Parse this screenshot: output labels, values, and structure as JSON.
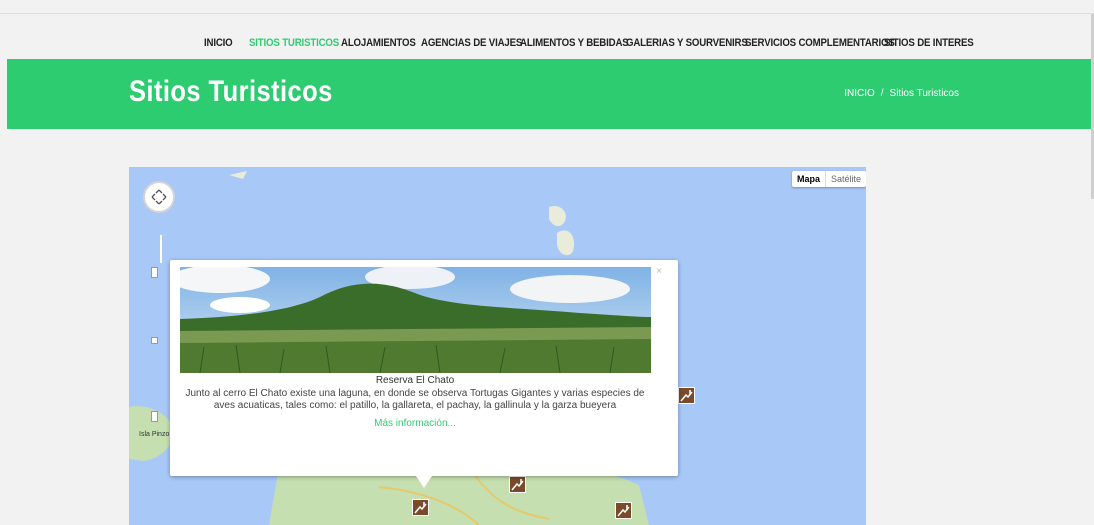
{
  "nav": {
    "items": [
      {
        "label": "INICIO",
        "active": false
      },
      {
        "label": "SITIOS TURISTICOS",
        "active": true
      },
      {
        "label": "ALOJAMIENTOS",
        "active": false
      },
      {
        "label": "AGENCIAS DE VIAJES",
        "active": false
      },
      {
        "label": "ALIMENTOS Y BEBIDAS",
        "active": false
      },
      {
        "label": "GALERIAS Y SOURVENIRS",
        "active": false
      },
      {
        "label": "SERVICIOS COMPLEMENTARIOS",
        "active": false
      },
      {
        "label": "SITIOS DE INTERES",
        "active": false
      }
    ]
  },
  "hero": {
    "title": "Sitios Turisticos",
    "breadcrumb": {
      "home": "INICIO",
      "separator": "/",
      "current": "Sitios Turisticos"
    }
  },
  "map": {
    "type_buttons": {
      "map": "Mapa",
      "satellite": "Satélite"
    },
    "island_label": "Isla Pinzo",
    "popup": {
      "title": "Reserva El Chato",
      "description": "Junto al cerro El Chato existe una laguna, en donde se observa Tortugas Gigantes y varias especies de aves acuaticas, tales como: el patillo, la gallareta, el pachay, la gallinula y la garza bueyera",
      "link": "Más información...",
      "close": "×"
    },
    "icons": {
      "pan": "pan-control-icon",
      "poi": "tourist-site-marker-icon"
    }
  },
  "colors": {
    "accent": "#2ecc71",
    "water": "#a8c8f8",
    "land": "#c5dfb0",
    "marker": "#7a4a2a"
  }
}
